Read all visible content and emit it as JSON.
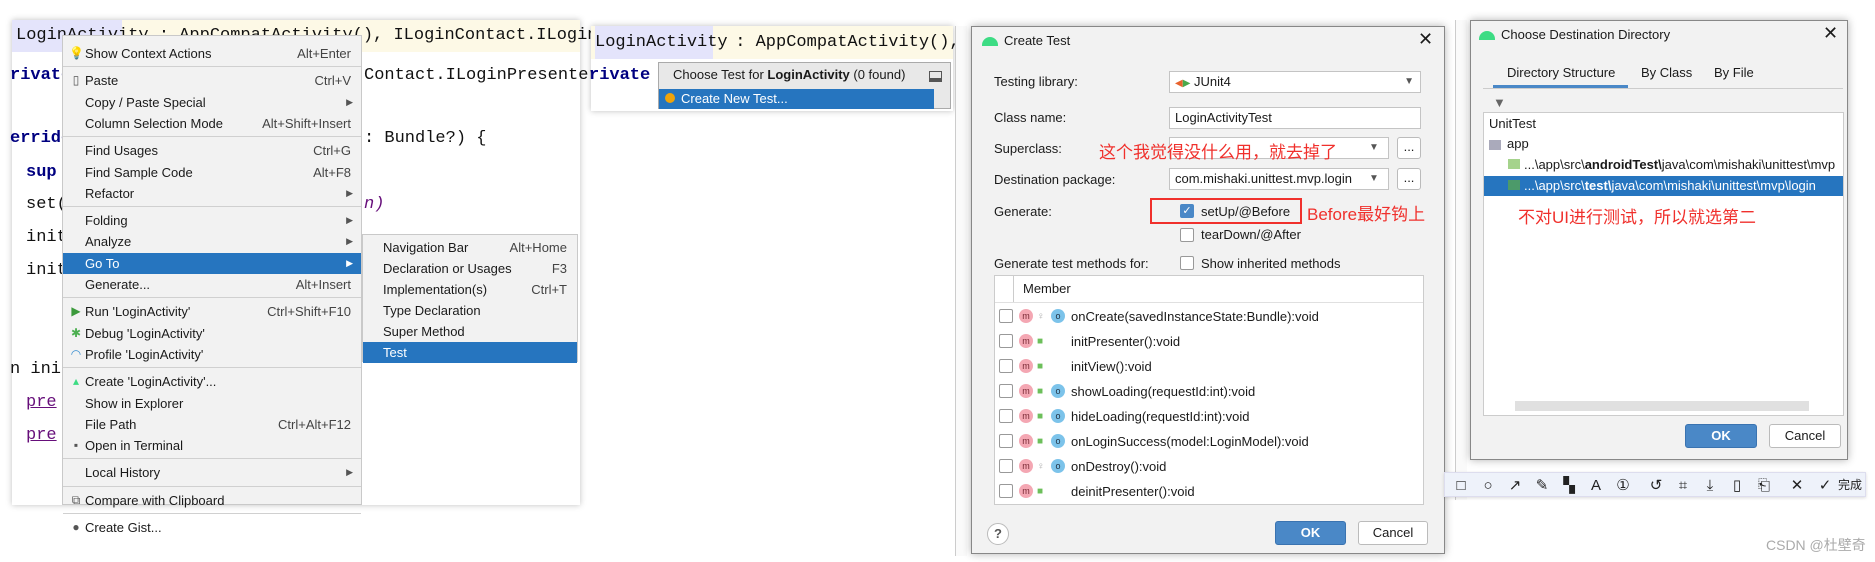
{
  "panel1": {
    "code_lines": [
      "LoginActivity : AppCompatActivity(), ILoginContact.ILoginView",
      "rivate",
      "Contact.ILoginPresenter",
      "erride",
      ": Bundle?) {",
      "sup",
      "set(",
      "n)",
      "init",
      "init",
      "n ini",
      "pre",
      "pre"
    ],
    "context_menu": [
      {
        "icon": "bulb-icon",
        "label": "Show Context Actions",
        "shortcut": "Alt+Enter"
      },
      {
        "icon": "clipboard-icon",
        "label": "Paste",
        "shortcut": "Ctrl+V"
      },
      {
        "label": "Copy / Paste Special",
        "submenu": true
      },
      {
        "label": "Column Selection Mode",
        "shortcut": "Alt+Shift+Insert"
      },
      {
        "label": "Find Usages",
        "shortcut": "Ctrl+G"
      },
      {
        "label": "Find Sample Code",
        "shortcut": "Alt+F8"
      },
      {
        "label": "Refactor",
        "submenu": true
      },
      {
        "label": "Folding",
        "submenu": true
      },
      {
        "label": "Analyze",
        "submenu": true
      },
      {
        "label": "Go To",
        "submenu": true,
        "selected": true
      },
      {
        "label": "Generate...",
        "shortcut": "Alt+Insert"
      },
      {
        "icon": "run-icon",
        "label": "Run 'LoginActivity'",
        "shortcut": "Ctrl+Shift+F10"
      },
      {
        "icon": "debug-icon",
        "label": "Debug 'LoginActivity'"
      },
      {
        "icon": "profile-icon",
        "label": "Profile 'LoginActivity'"
      },
      {
        "icon": "android-icon",
        "label": "Create 'LoginActivity'..."
      },
      {
        "label": "Show in Explorer"
      },
      {
        "label": "File Path",
        "shortcut": "Ctrl+Alt+F12"
      },
      {
        "icon": "terminal-icon",
        "label": "Open in Terminal"
      },
      {
        "label": "Local History",
        "submenu": true
      },
      {
        "icon": "compare-icon",
        "label": "Compare with Clipboard"
      },
      {
        "icon": "github-icon",
        "label": "Create Gist..."
      }
    ],
    "submenu": [
      {
        "label": "Navigation Bar",
        "shortcut": "Alt+Home"
      },
      {
        "label": "Declaration or Usages",
        "shortcut": "F3"
      },
      {
        "label": "Implementation(s)",
        "shortcut": "Ctrl+T"
      },
      {
        "label": "Type Declaration"
      },
      {
        "label": "Super Method"
      },
      {
        "label": "Test",
        "selected": true
      }
    ]
  },
  "panel2": {
    "code_class": "LoginActivity",
    "code_rest": " : AppCompatActivity(), ILo",
    "code_line2": "rivate l",
    "popup_title_pre": "Choose Test for ",
    "popup_title_bold": "LoginActivity",
    "popup_title_post": " (0 found)",
    "create_new": "Create New Test..."
  },
  "create_test": {
    "title": "Create Test",
    "testing_library_label": "Testing library:",
    "testing_library_value": "JUnit4",
    "class_name_label": "Class name:",
    "class_name_value": "LoginActivityTest",
    "superclass_label": "Superclass:",
    "superclass_value": "",
    "destination_label": "Destination package:",
    "destination_value": "com.mishaki.unittest.mvp.login",
    "browse": "...",
    "generate_label": "Generate:",
    "setup_label": "setUp/@Before",
    "setup_checked": true,
    "teardown_label": "tearDown/@After",
    "teardown_checked": false,
    "methods_label": "Generate test methods for:",
    "inherited_label": "Show inherited methods",
    "column_header": "Member",
    "members": [
      {
        "name": "onCreate(savedInstanceState:Bundle):void",
        "access": "protected",
        "override": true
      },
      {
        "name": "initPresenter():void",
        "access": "public",
        "override": false
      },
      {
        "name": "initView():void",
        "access": "public",
        "override": false
      },
      {
        "name": "showLoading(requestId:int):void",
        "access": "public",
        "override": true
      },
      {
        "name": "hideLoading(requestId:int):void",
        "access": "public",
        "override": true
      },
      {
        "name": "onLoginSuccess(model:LoginModel):void",
        "access": "public",
        "override": true
      },
      {
        "name": "onDestroy():void",
        "access": "protected",
        "override": true
      },
      {
        "name": "deinitPresenter():void",
        "access": "public",
        "override": false
      }
    ],
    "ok": "OK",
    "cancel": "Cancel",
    "help": "?",
    "annotation_superclass": "这个我觉得没什么用，就去掉了",
    "annotation_before": "Before最好钩上"
  },
  "choose_dir": {
    "title": "Choose Destination Directory",
    "tabs": [
      "Directory Structure",
      "By Class",
      "By File"
    ],
    "active_tab": 0,
    "tree": {
      "root": "UnitTest",
      "module": "app",
      "dirs": [
        {
          "pre": "...\\app\\src\\",
          "bold": "androidTest\\",
          "post": "java\\com\\mishaki\\unittest\\mvp",
          "selected": false
        },
        {
          "pre": "...\\app\\src\\",
          "bold": "test\\",
          "post": "java\\com\\mishaki\\unittest\\mvp\\login",
          "selected": true
        }
      ]
    },
    "annotation": "不对UI进行测试，所以就选第二",
    "ok": "OK",
    "cancel": "Cancel"
  },
  "toolbar": {
    "tools": [
      "rectangle-icon",
      "circle-icon",
      "arrow-icon",
      "pencil-icon",
      "mosaic-icon",
      "text-icon",
      "number-icon",
      "undo-icon",
      "pin-icon",
      "download-icon",
      "phone-icon",
      "bookmark-icon",
      "close-icon",
      "check-icon"
    ],
    "done": "完成"
  },
  "watermark": "CSDN @杜壁奇",
  "colors": {
    "accent": "#2675bf",
    "annotation": "#f0302c",
    "ok_button": "#4a88c7"
  }
}
